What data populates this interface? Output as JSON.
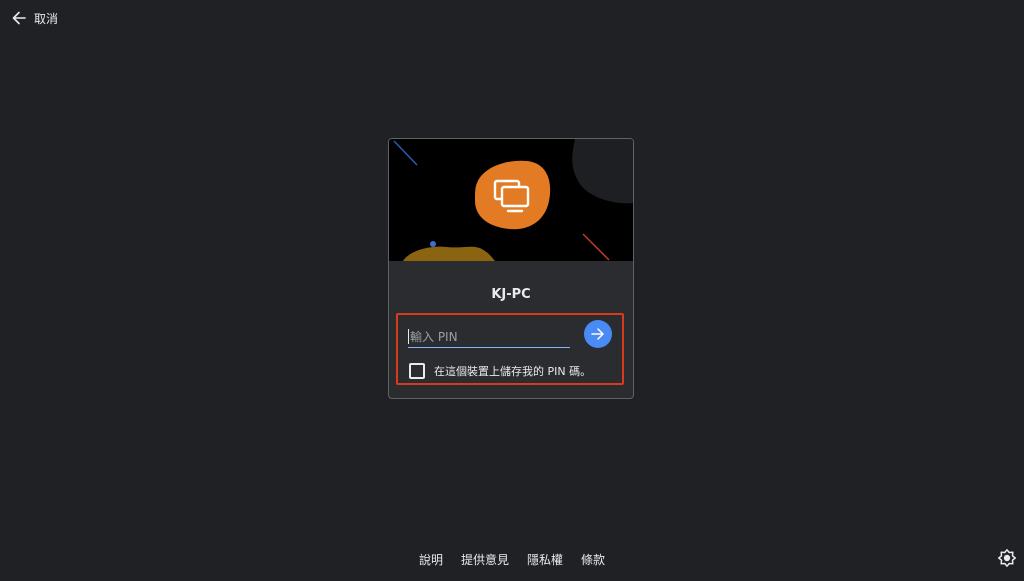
{
  "topbar": {
    "cancel_label": "取消",
    "back_icon": "arrow-left-icon"
  },
  "card": {
    "hostname": "KJ-PC",
    "banner_icon": "remote-desktop-icon",
    "pin_placeholder": "輸入 PIN",
    "pin_value": "",
    "submit_icon": "arrow-right-icon",
    "remember_label": "在這個裝置上儲存我的 PIN 碼。",
    "remember_checked": false
  },
  "footer": {
    "links": [
      "說明",
      "提供意見",
      "隱私權",
      "條款"
    ]
  },
  "settings_icon": "brightness-icon",
  "colors": {
    "background": "#202124",
    "card": "#2b2c2f",
    "accent": "#4a8af4",
    "highlight": "#d93a1c",
    "banner_blob": "#e37b24"
  }
}
